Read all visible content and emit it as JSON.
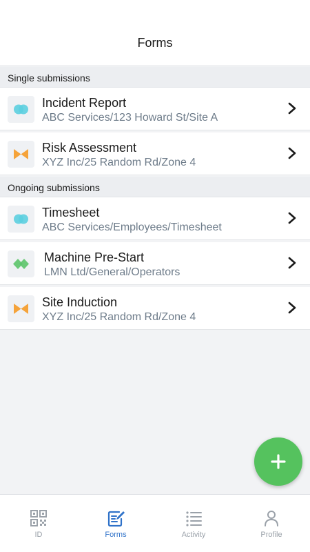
{
  "header": {
    "title": "Forms"
  },
  "sections": [
    {
      "label": "Single submissions"
    },
    {
      "label": "Ongoing submissions"
    }
  ],
  "forms": [
    {
      "name": "Incident Report",
      "path": "ABC Services/123 Howard St/Site A",
      "icon": "blue-circles-icon"
    },
    {
      "name": "Risk Assessment",
      "path": "XYZ Inc/25 Random Rd/Zone 4",
      "icon": "orange-bowtie-icon"
    },
    {
      "name": "Timesheet",
      "path": "ABC Services/Employees/Timesheet",
      "icon": "blue-circles-icon"
    },
    {
      "name": "Machine Pre-Start",
      "path": "LMN Ltd/General/Operators",
      "icon": "green-diamonds-icon"
    },
    {
      "name": "Site Induction",
      "path": "XYZ Inc/25 Random Rd/Zone 4",
      "icon": "orange-bowtie-icon"
    }
  ],
  "fab": {
    "icon": "plus-icon",
    "color": "#55c25e"
  },
  "nav": [
    {
      "label": "ID",
      "icon": "qr-code-icon",
      "active": false
    },
    {
      "label": "Forms",
      "icon": "form-edit-icon",
      "active": true
    },
    {
      "label": "Activity",
      "icon": "list-icon",
      "active": false
    },
    {
      "label": "Profile",
      "icon": "person-icon",
      "active": false
    }
  ],
  "colors": {
    "accent": "#2f72c9",
    "teal": "#5ccfe0",
    "orange": "#f5a33a",
    "green": "#5cc46a",
    "muted_text": "#6e7c8a"
  }
}
